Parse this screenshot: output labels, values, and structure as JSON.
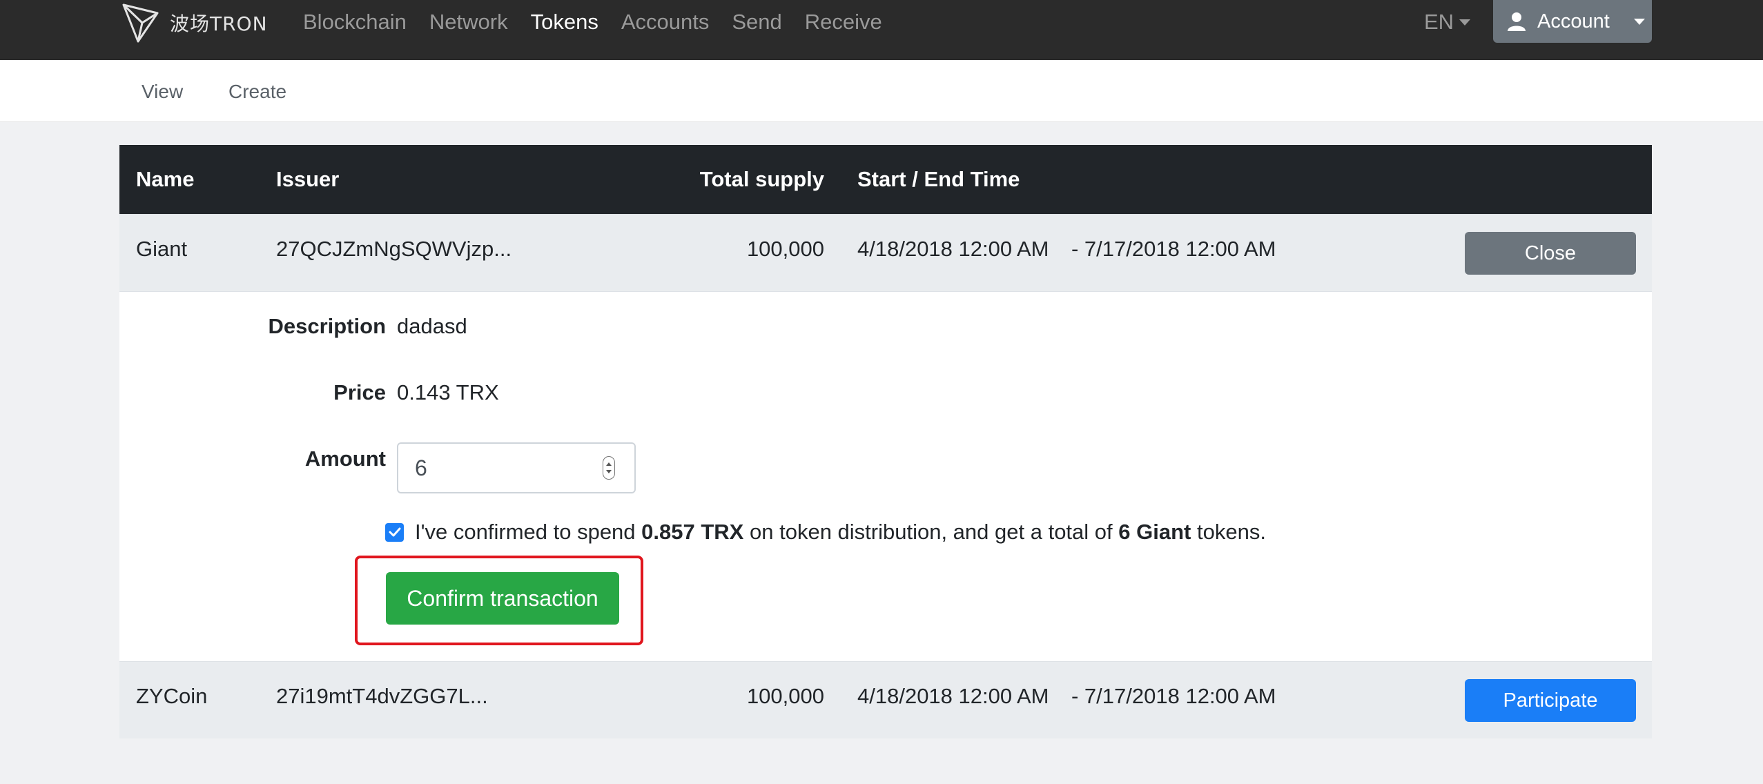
{
  "navbar": {
    "logo_text": "波场TRON",
    "links": [
      "Blockchain",
      "Network",
      "Tokens",
      "Accounts",
      "Send",
      "Receive"
    ],
    "active_link": "Tokens",
    "language": "EN",
    "account_label": "Account"
  },
  "subnav": {
    "view_label": "View",
    "create_label": "Create"
  },
  "table": {
    "headers": {
      "name": "Name",
      "issuer": "Issuer",
      "total_supply": "Total supply",
      "time": "Start / End Time"
    },
    "rows": [
      {
        "name": "Giant",
        "issuer": "27QCJZmNgSQWVjzp...",
        "total_supply": "100,000",
        "start_time": "4/18/2018 12:00 AM",
        "end_time": "- 7/17/2018 12:00 AM",
        "action": "Close"
      },
      {
        "name": "ZYCoin",
        "issuer": "27i19mtT4dvZGG7L...",
        "total_supply": "100,000",
        "start_time": "4/18/2018 12:00 AM",
        "end_time": "- 7/17/2018 12:00 AM",
        "action": "Participate"
      }
    ]
  },
  "detail": {
    "description_label": "Description",
    "description_value": "dadasd",
    "price_label": "Price",
    "price_value": "0.143 TRX",
    "amount_label": "Amount",
    "amount_value": "6",
    "confirm_prefix": "I've confirmed to spend",
    "confirm_amount": "0.857 TRX",
    "confirm_middle": "on token distribution, and get a total of",
    "confirm_tokens": "6 Giant",
    "confirm_suffix": "tokens.",
    "checkbox_checked": true,
    "confirm_button": "Confirm transaction"
  },
  "colors": {
    "navbar": "#2b2b2b",
    "table_header": "#212529",
    "row_bg": "#e9ecef",
    "close_button": "#6c757d",
    "participate_button": "#1a7ef7",
    "confirm_button": "#28a745",
    "highlight": "#e0161e"
  },
  "icons": [
    "tron-logo-icon",
    "chevron-down-icon",
    "user-icon",
    "checkmark-icon",
    "spinner-arrows-icon"
  ]
}
